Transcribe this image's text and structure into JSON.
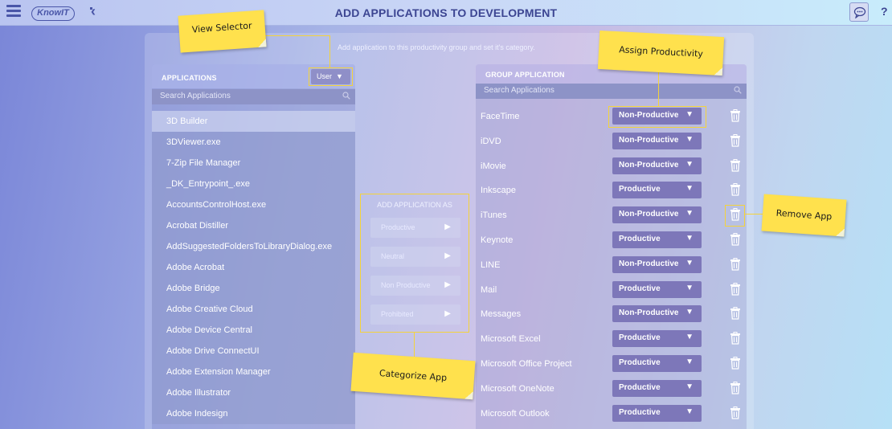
{
  "topbar": {
    "title": "ADD APPLICATIONS TO DEVELOPMENT",
    "logo": "KnowIT",
    "back": "‹",
    "help": "?"
  },
  "subtitle": "Add application to this productivity group and set it's category.",
  "applications": {
    "header": "APPLICATIONS",
    "view_selector": "User",
    "search_placeholder": "Search Applications",
    "items": [
      "3D Builder",
      "3DViewer.exe",
      "7-Zip File Manager",
      "_DK_Entrypoint_.exe",
      "AccountsControlHost.exe",
      "Acrobat Distiller",
      "AddSuggestedFoldersToLibraryDialog.exe",
      "Adobe Acrobat",
      "Adobe Bridge",
      "Adobe Creative Cloud",
      "Adobe Device Central",
      "Adobe Drive ConnectUI",
      "Adobe Extension Manager",
      "Adobe Illustrator",
      "Adobe Indesign"
    ]
  },
  "categorize": {
    "header": "ADD APPLICATION AS",
    "buttons": [
      "Productive",
      "Neutral",
      "Non Productive",
      "Prohibited"
    ]
  },
  "group": {
    "header": "GROUP APPLICATION",
    "search_placeholder": "Search Applications",
    "rows": [
      {
        "name": "FaceTime",
        "category": "Non-Productive"
      },
      {
        "name": "iDVD",
        "category": "Non-Productive"
      },
      {
        "name": "iMovie",
        "category": "Non-Productive"
      },
      {
        "name": "Inkscape",
        "category": "Productive"
      },
      {
        "name": "iTunes",
        "category": "Non-Productive"
      },
      {
        "name": "Keynote",
        "category": "Productive"
      },
      {
        "name": "LINE",
        "category": "Non-Productive"
      },
      {
        "name": "Mail",
        "category": "Productive"
      },
      {
        "name": "Messages",
        "category": "Non-Productive"
      },
      {
        "name": "Microsoft Excel",
        "category": "Productive"
      },
      {
        "name": "Microsoft Office Project",
        "category": "Productive"
      },
      {
        "name": "Microsoft OneNote",
        "category": "Productive"
      },
      {
        "name": "Microsoft Outlook",
        "category": "Productive"
      }
    ]
  },
  "callouts": {
    "view_selector": "View Selector",
    "assign_productivity": "Assign Productivity",
    "remove_app": "Remove App",
    "categorize_app": "Categorize App"
  }
}
